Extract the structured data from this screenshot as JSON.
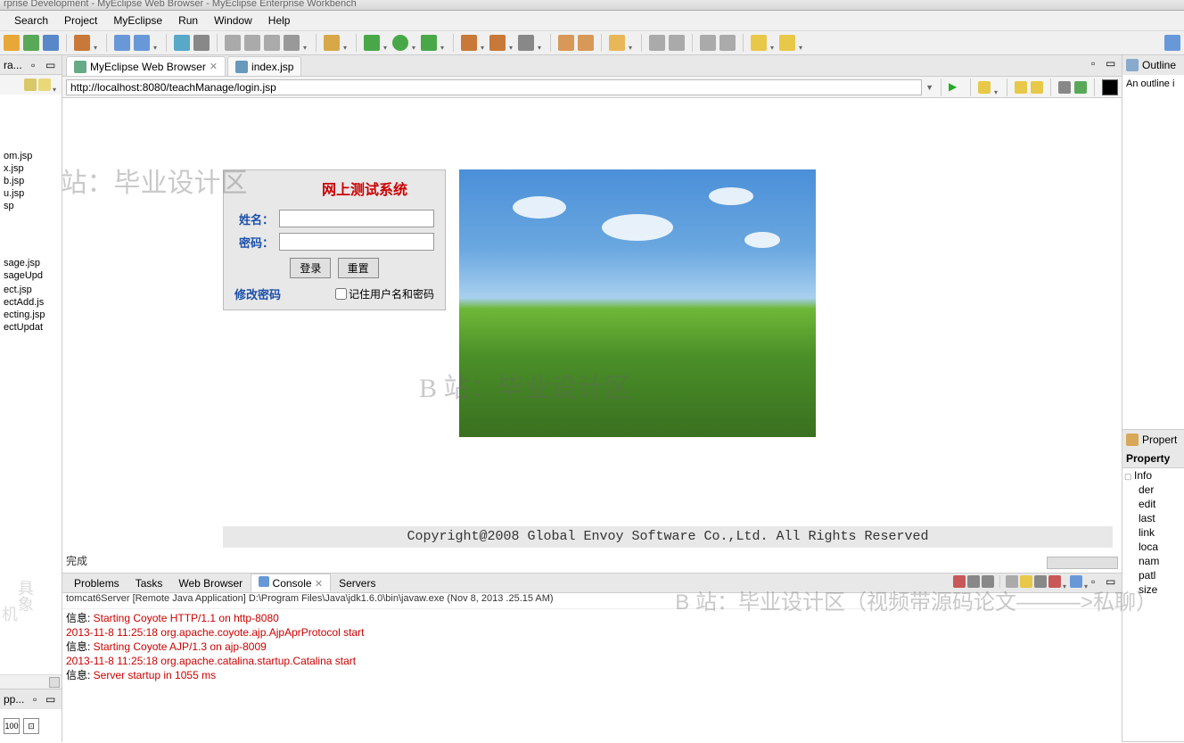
{
  "title_partial": "rprise Development - MyEclipse Web Browser - MyEclipse Enterprise Workbench",
  "menu": [
    "Search",
    "Project",
    "MyEclipse",
    "Run",
    "Window",
    "Help"
  ],
  "left": {
    "hdr": "ra...",
    "files1": [
      "om.jsp",
      "x.jsp",
      "b.jsp",
      "u.jsp",
      "sp"
    ],
    "files2": [
      "sage.jsp",
      "sageUpd",
      "",
      "ect.jsp",
      "ectAdd.js",
      "ecting.jsp",
      "ectUpdat"
    ],
    "bottom_hdr": "pp..."
  },
  "tabs": {
    "t1": "MyEclipse Web Browser",
    "t2": "index.jsp"
  },
  "url": "http://localhost:8080/teachManage/login.jsp",
  "login": {
    "title": "网上测试系统",
    "name_label": "姓名：",
    "pw_label": "密码：",
    "login_btn": "登录",
    "reset_btn": "重置",
    "change_pw": "修改密码",
    "remember": "记住用户名和密码"
  },
  "copyright": "Copyright@2008 Global Envoy Software Co.,Ltd. All Rights Reserved",
  "status": "完成",
  "bottom_tabs": [
    "Problems",
    "Tasks",
    "Web Browser",
    "Console",
    "Servers"
  ],
  "console": {
    "hdr": "tomcat6Server [Remote Java Application] D:\\Program Files\\Java\\jdk1.6.0\\bin\\javaw.exe (Nov 8, 2013  .25.15 AM)",
    "lines": [
      {
        "p": "信息: ",
        "m": "Starting Coyote HTTP/1.1 on http-8080"
      },
      {
        "p": "",
        "m": "2013-11-8 11:25:18 org.apache.coyote.ajp.AjpAprProtocol start"
      },
      {
        "p": "信息: ",
        "m": "Starting Coyote AJP/1.3 on ajp-8009"
      },
      {
        "p": "",
        "m": "2013-11-8 11:25:18 org.apache.catalina.startup.Catalina start"
      },
      {
        "p": "信息: ",
        "m": "Server startup in 1055 ms"
      }
    ]
  },
  "right": {
    "outline_hdr": "Outline",
    "outline_body": "An outline i",
    "props_hdr": "Propert",
    "prop_col": "Property",
    "prop_group": "Info",
    "props": [
      "der",
      "edit",
      "last",
      "link",
      "loca",
      "nam",
      "patl",
      "size"
    ]
  },
  "watermarks": {
    "w1": "B 站：毕业设计区",
    "w2": "B 站：毕业设计区",
    "w3": "B 站：毕业设计区（视频带源码论文———>私聊）"
  }
}
